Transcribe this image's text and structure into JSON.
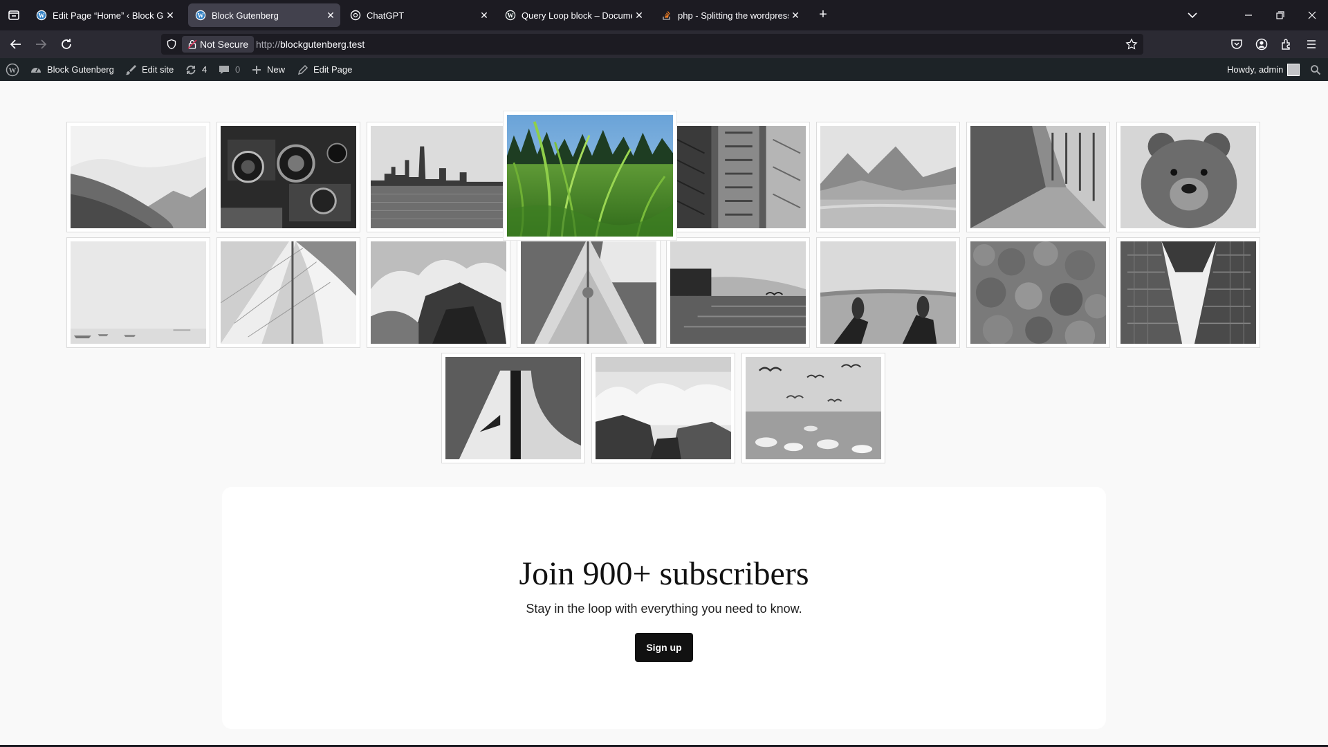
{
  "browser": {
    "tabs": [
      {
        "title": "Edit Page “Home” ‹ Block Gutenberg",
        "active": false,
        "favicon": "wordpress-icon"
      },
      {
        "title": "Block Gutenberg",
        "active": true,
        "favicon": "wordpress-icon"
      },
      {
        "title": "ChatGPT",
        "active": false,
        "favicon": "chatgpt-icon"
      },
      {
        "title": "Query Loop block – Documentation",
        "active": false,
        "favicon": "wordpress-icon"
      },
      {
        "title": "php - Splitting the wordpress loop",
        "active": false,
        "favicon": "stackoverflow-icon"
      }
    ],
    "close_glyph": "✕",
    "new_tab_glyph": "+",
    "security_label": "Not Secure",
    "url_scheme": "http://",
    "url_host": "blockgutenberg.test"
  },
  "admin_bar": {
    "site_name": "Block Gutenberg",
    "edit_site": "Edit site",
    "updates_count": "4",
    "comments_count": "0",
    "new_label": "New",
    "edit_page": "Edit Page",
    "howdy": "Howdy, admin"
  },
  "gallery": {
    "images": [
      {
        "subject": "misty mountain hillside",
        "style": "grayscale"
      },
      {
        "subject": "vintage film cameras",
        "style": "grayscale"
      },
      {
        "subject": "city skyline over water",
        "style": "grayscale"
      },
      {
        "subject": "green grass close-up",
        "style": "color",
        "hovered": true
      },
      {
        "subject": "fire escapes on building",
        "style": "grayscale"
      },
      {
        "subject": "mountain valley",
        "style": "grayscale"
      },
      {
        "subject": "corridor with windows",
        "style": "grayscale"
      },
      {
        "subject": "bear portrait",
        "style": "grayscale"
      },
      {
        "subject": "foggy sea with boats",
        "style": "grayscale"
      },
      {
        "subject": "sailboat sail",
        "style": "grayscale"
      },
      {
        "subject": "waves on rocks",
        "style": "grayscale"
      },
      {
        "subject": "sailboat bow",
        "style": "grayscale"
      },
      {
        "subject": "pier at sunset",
        "style": "grayscale"
      },
      {
        "subject": "feet on grass",
        "style": "grayscale"
      },
      {
        "subject": "forest from above",
        "style": "grayscale"
      },
      {
        "subject": "skyscrapers looking up",
        "style": "grayscale"
      },
      {
        "subject": "abstract architecture",
        "style": "grayscale"
      },
      {
        "subject": "surf on rocks",
        "style": "grayscale"
      },
      {
        "subject": "seagulls and swans",
        "style": "grayscale"
      }
    ]
  },
  "subscribe": {
    "heading": "Join 900+ subscribers",
    "text": "Stay in the loop with everything you need to know.",
    "button": "Sign up"
  },
  "colors": {
    "browser_bg": "#1c1b22",
    "toolbar_bg": "#2b2a33",
    "wp_admin_bar": "#1d2327",
    "page_bg": "#f9f9f9",
    "button_bg": "#111111"
  }
}
